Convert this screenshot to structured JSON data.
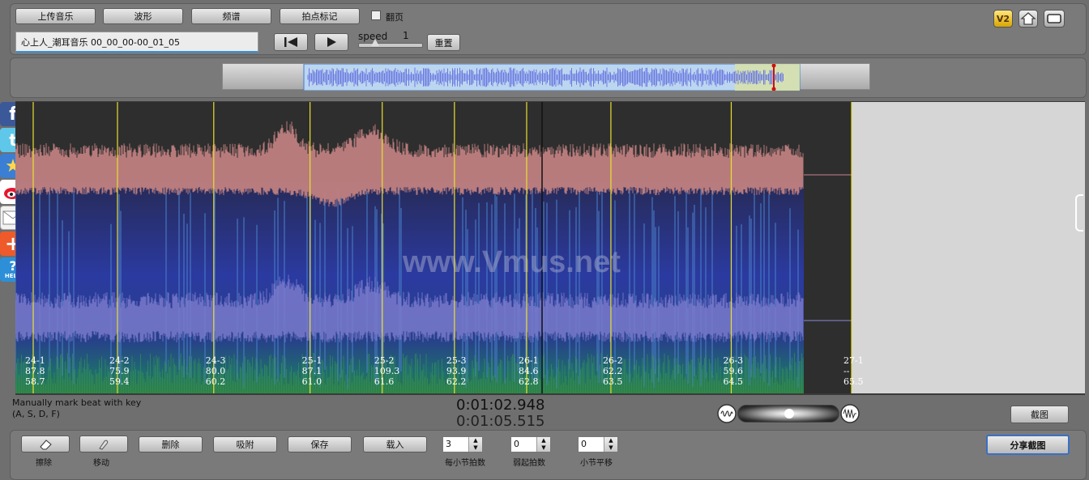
{
  "toolbar": {
    "upload_label": "上传音乐",
    "waveform_label": "波形",
    "spectrum_label": "频谱",
    "beat_mark_label": "拍点标记",
    "page_turn_label": "翻页",
    "page_turn_checked": false
  },
  "file": {
    "name": "心上人_潮耳音乐 00_00_00-00_01_05"
  },
  "playback": {
    "speed_label": "speed",
    "speed_value": "1",
    "speed_fraction": 0.25,
    "reset_label": "重置"
  },
  "app": {
    "version_badge": "V2"
  },
  "overview": {
    "selection_start": 0.0,
    "selection_end": 0.89,
    "playhead": 0.85
  },
  "share_icons": [
    "facebook-icon",
    "twitter-icon",
    "favorite-star-icon",
    "weibo-icon",
    "email-icon",
    "add-plus-icon",
    "help-icon"
  ],
  "share": {
    "help_text": "HELP"
  },
  "spectrogram": {
    "watermark": "www.Vmus.net",
    "beats": [
      {
        "label": "24-1",
        "bpm": "87.8",
        "time": "58.7"
      },
      {
        "label": "24-2",
        "bpm": "75.9",
        "time": "59.4"
      },
      {
        "label": "24-3",
        "bpm": "80.0",
        "time": "60.2"
      },
      {
        "label": "25-1",
        "bpm": "87.1",
        "time": "61.0"
      },
      {
        "label": "25-2",
        "bpm": "109.3",
        "time": "61.6"
      },
      {
        "label": "25-3",
        "bpm": "93.9",
        "time": "62.2"
      },
      {
        "label": "26-1",
        "bpm": "84.6",
        "time": "62.8"
      },
      {
        "label": "26-2",
        "bpm": "62.2",
        "time": "63.5"
      },
      {
        "label": "26-3",
        "bpm": "59.6",
        "time": "64.5"
      },
      {
        "label": "27-1",
        "bpm": "--",
        "time": "65.5"
      }
    ],
    "colors": {
      "beat_line": "#e8e030",
      "background": "#2e2e2e",
      "pink": "#c08080",
      "purple": "#7a7acc"
    }
  },
  "status": {
    "hint_line1": "Manually mark beat with key",
    "hint_line2": "(A, S, D, F)",
    "current_time": "0:01:02.948",
    "total_time": "0:01:05.515",
    "volume_fraction": 0.5,
    "screenshot_label": "截图"
  },
  "bottom": {
    "erase_label": "擦除",
    "move_label": "移动",
    "delete_label": "删除",
    "snap_label": "吸附",
    "save_label": "保存",
    "load_label": "载入",
    "beats_per_bar_value": "3",
    "beats_per_bar_label": "每小节拍数",
    "pickup_value": "0",
    "pickup_label": "弱起拍数",
    "bar_shift_value": "0",
    "bar_shift_label": "小节平移",
    "share_screenshot_label": "分享截图"
  }
}
